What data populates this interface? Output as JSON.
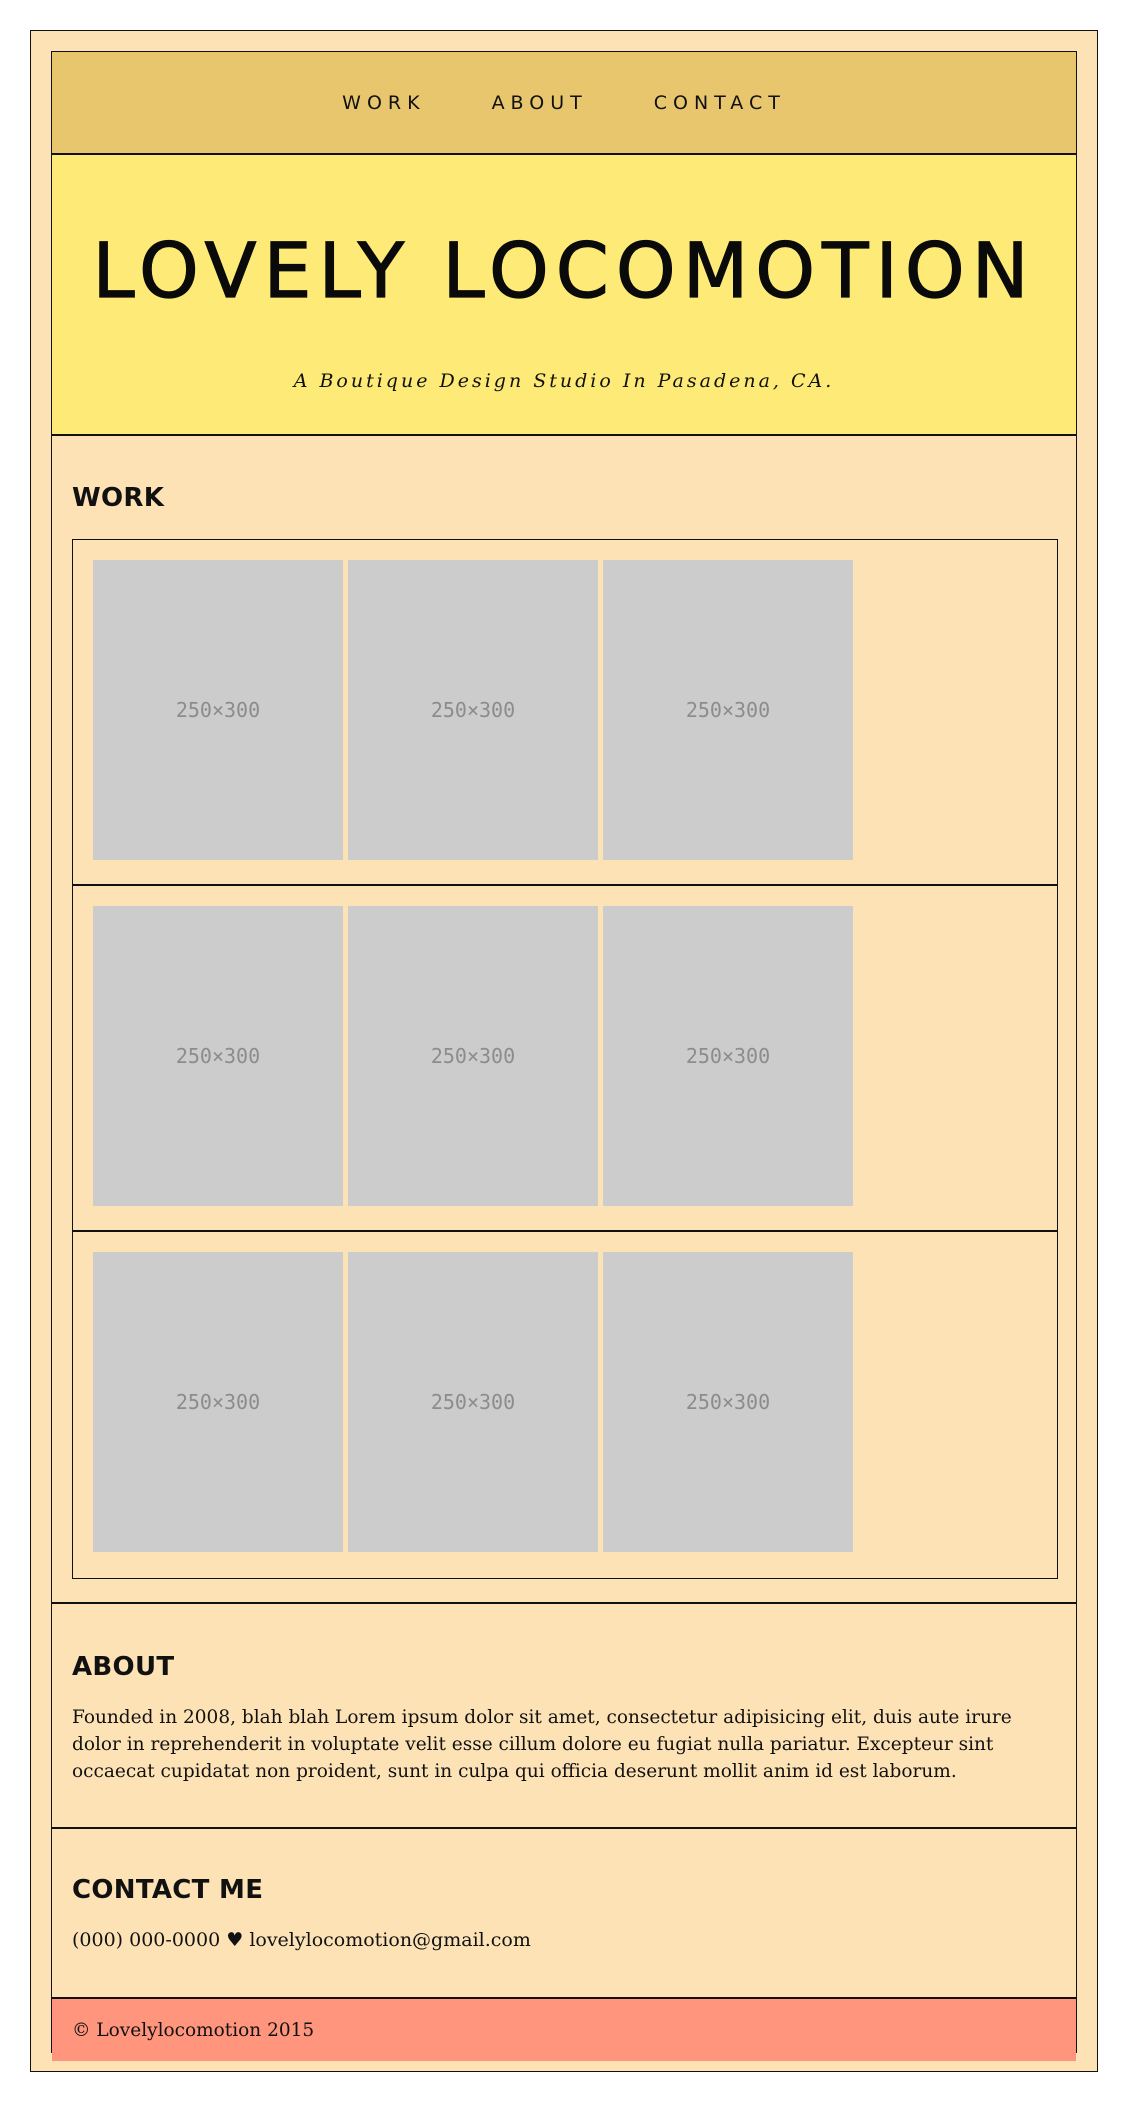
{
  "nav": {
    "items": [
      {
        "label": "WORK"
      },
      {
        "label": "ABOUT"
      },
      {
        "label": "CONTACT"
      }
    ]
  },
  "hero": {
    "title": "LOVELY LOCOMOTION",
    "subtitle": "A Boutique Design Studio In Pasadena, CA."
  },
  "work": {
    "heading": "WORK",
    "rows": [
      {
        "thumbs": [
          "250×300",
          "250×300",
          "250×300"
        ]
      },
      {
        "thumbs": [
          "250×300",
          "250×300",
          "250×300"
        ]
      },
      {
        "thumbs": [
          "250×300",
          "250×300",
          "250×300"
        ]
      }
    ]
  },
  "about": {
    "heading": "ABOUT",
    "text": "Founded in 2008, blah blah Lorem ipsum dolor sit amet, consectetur adipisicing elit, duis aute irure dolor in reprehenderit in voluptate velit esse cillum dolore eu fugiat nulla pariatur. Excepteur sint occaecat cupidatat non proident, sunt in culpa qui officia deserunt mollit anim id est laborum."
  },
  "contact": {
    "heading": "CONTACT ME",
    "phone": "(000) 000-0000",
    "separator": "♥",
    "email": "lovelylocomotion@gmail.com"
  },
  "footer": {
    "text": "© Lovelylocomotion 2015"
  },
  "colors": {
    "page_bg": "#fde2b6",
    "nav_bg": "#e8c66e",
    "hero_bg": "#feeb77",
    "footer_bg": "#ff957d",
    "thumb_bg": "#cccccc"
  }
}
